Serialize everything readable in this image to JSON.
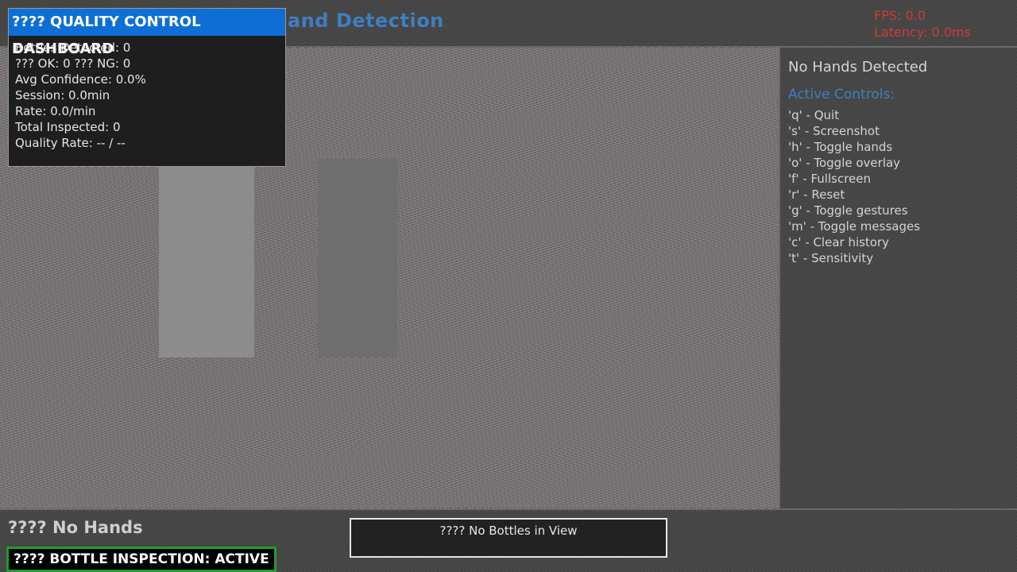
{
  "header": {
    "title": "and Detection",
    "fps": "FPS: 0.0",
    "latency": "Latency: 0.0ms"
  },
  "dashboard": {
    "title": "???? QUALITY CONTROL DASHBOARD",
    "stats": [
      "Bottles Detected: 0",
      "??? OK: 0  ??? NG: 0",
      "Avg Confidence: 0.0%",
      "Session: 0.0min",
      "Rate: 0.0/min",
      "Total Inspected: 0",
      "Quality Rate: -- / --"
    ]
  },
  "right_panel": {
    "hands_status": "No Hands Detected",
    "controls_title": "Active Controls:",
    "controls": [
      "'q' - Quit",
      "'s' - Screenshot",
      "'h' - Toggle hands",
      "'o' - Toggle overlay",
      "'f' - Fullscreen",
      "'r' - Reset",
      "'g' - Toggle gestures",
      "'m' - Toggle messages",
      "'c' - Clear history",
      "'t' - Sensitivity"
    ]
  },
  "bottom": {
    "hands_indicator": "???? No Hands",
    "inspection_status": "???? BOTTLE INSPECTION: ACTIVE",
    "bottle_view": "???? No Bottles in View"
  },
  "colors": {
    "accent_blue": "#0d6fd6",
    "title_blue": "#3f7fc0",
    "alert_red": "#d03a3a",
    "status_green": "#1f9d2a"
  }
}
